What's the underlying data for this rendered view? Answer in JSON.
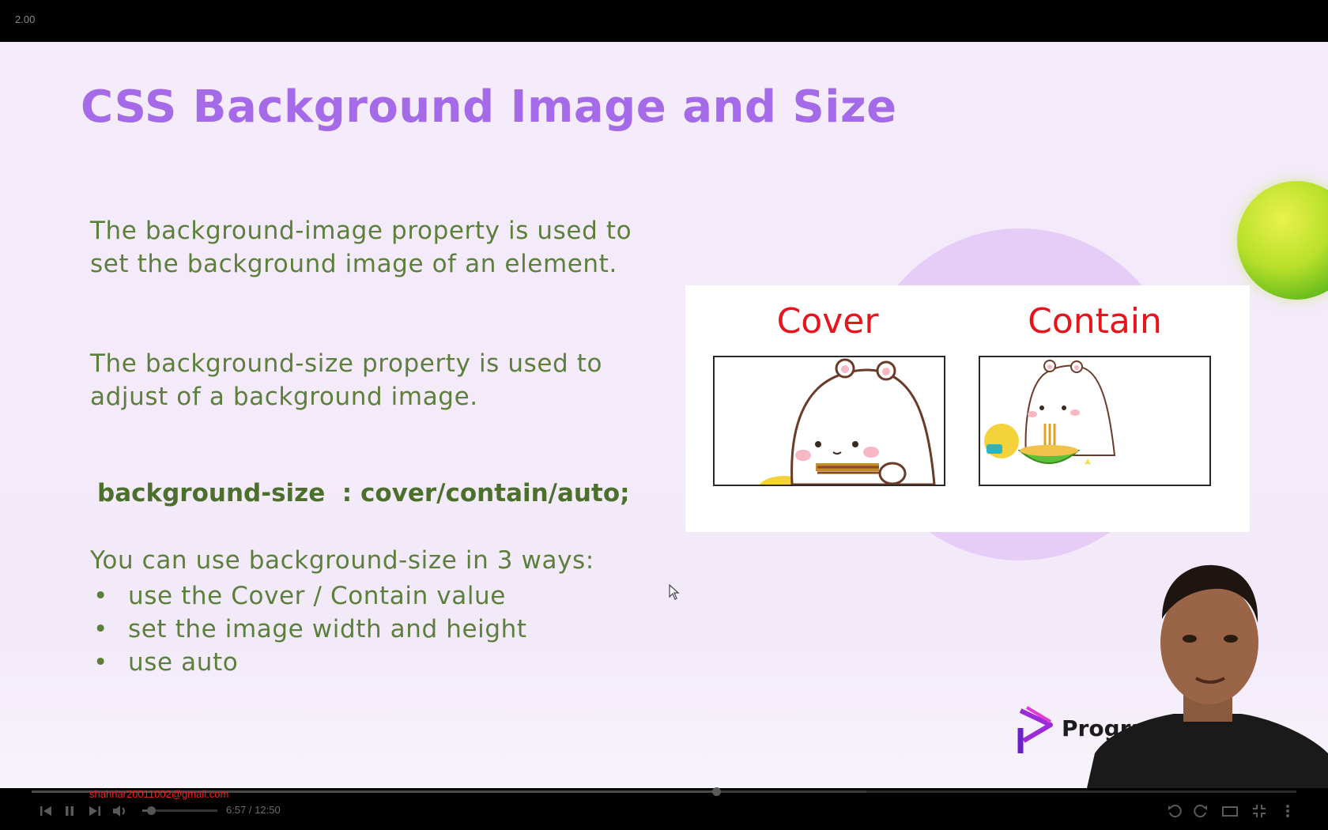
{
  "player": {
    "playback_speed": "2.00",
    "overlay_email": "shahriar20011002@gmail.com",
    "time_current": "6:57",
    "time_separator": " / ",
    "time_total": "12:50",
    "progress_fraction": 0.5411,
    "buffered_fraction": 0.66,
    "volume_fraction": 0.12
  },
  "slide": {
    "title": "CSS Background Image and Size",
    "paragraph_1": "The background-image property is used to set the background image of an element.",
    "paragraph_2": "The background-size property is used to adjust of a background image.",
    "code_line": "background-size  : cover/contain/auto;",
    "ways_intro": "You can use background-size in 3 ways:",
    "bullet_glyph": "•",
    "ways": [
      "use the Cover / Contain value",
      "set the image width and height",
      "use auto"
    ],
    "demo": {
      "cover_label": "Cover",
      "contain_label": "Contain"
    },
    "logo_text": "Program"
  },
  "colors": {
    "title": "#a56ae8",
    "body_text": "#5c7f3c",
    "demo_label": "#e8141c",
    "email_overlay": "#ff1a1a"
  },
  "icons": [
    "skip-previous-icon",
    "pause-icon",
    "skip-next-icon",
    "volume-icon",
    "rewind-10-icon",
    "forward-10-icon",
    "theater-mode-icon",
    "exit-fullscreen-icon",
    "more-vert-icon"
  ]
}
